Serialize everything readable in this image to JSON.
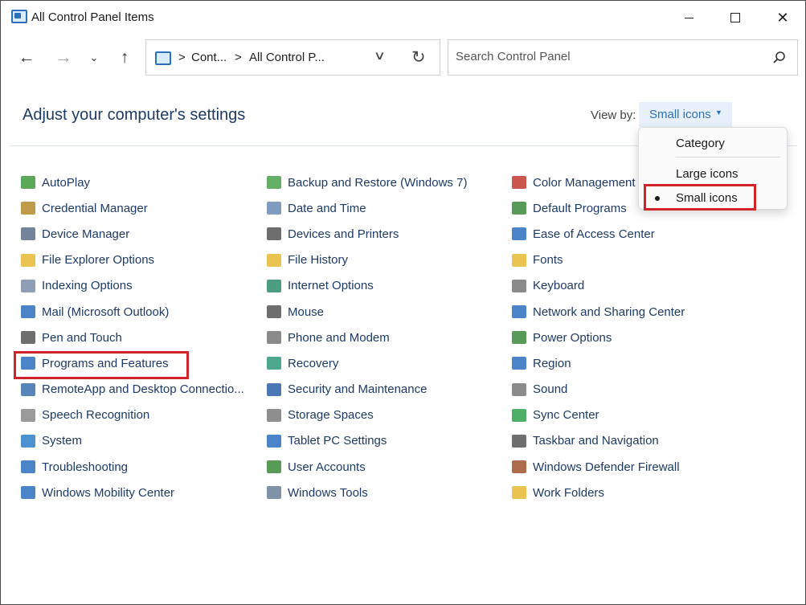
{
  "window": {
    "title": "All Control Panel Items",
    "close_glyph": "✕"
  },
  "nav": {
    "back_glyph": "←",
    "forward_glyph": "→",
    "recent_glyph": "⌄",
    "up_glyph": "↑"
  },
  "address": {
    "sep": ">",
    "segments": [
      "Cont...",
      "All Control P..."
    ],
    "dropdown_glyph": "∨",
    "refresh_glyph": "↻"
  },
  "search": {
    "placeholder": "Search Control Panel"
  },
  "header": {
    "title": "Adjust your computer's settings",
    "view_by_label": "View by:",
    "view_by_value": "Small icons",
    "view_by_caret": "▼"
  },
  "view_menu": {
    "items": [
      "Category",
      "Large icons",
      "Small icons"
    ],
    "selected": "Small icons"
  },
  "columns": [
    [
      {
        "label": "AutoPlay",
        "icon": "autoplay-icon",
        "color": "#3c9a3c"
      },
      {
        "label": "Credential Manager",
        "icon": "credential-manager-icon",
        "color": "#b58a2a"
      },
      {
        "label": "Device Manager",
        "icon": "device-manager-icon",
        "color": "#5a6f8a"
      },
      {
        "label": "File Explorer Options",
        "icon": "folder-options-icon",
        "color": "#e7b933"
      },
      {
        "label": "Indexing Options",
        "icon": "indexing-icon",
        "color": "#7a8ea8"
      },
      {
        "label": "Mail (Microsoft Outlook)",
        "icon": "mail-icon",
        "color": "#2d6fbf"
      },
      {
        "label": "Pen and Touch",
        "icon": "pen-icon",
        "color": "#555555"
      },
      {
        "label": "Programs and Features",
        "icon": "programs-icon",
        "color": "#2d6fbf"
      },
      {
        "label": "RemoteApp and Desktop Connectio...",
        "icon": "remoteapp-icon",
        "color": "#3b6fae"
      },
      {
        "label": "Speech Recognition",
        "icon": "microphone-icon",
        "color": "#8a8a8a"
      },
      {
        "label": "System",
        "icon": "system-icon",
        "color": "#2d7fc7"
      },
      {
        "label": "Troubleshooting",
        "icon": "troubleshooting-icon",
        "color": "#2d6fbf"
      },
      {
        "label": "Windows Mobility Center",
        "icon": "mobility-icon",
        "color": "#2d6fbf"
      }
    ],
    [
      {
        "label": "Backup and Restore (Windows 7)",
        "icon": "backup-icon",
        "color": "#4aa04a"
      },
      {
        "label": "Date and Time",
        "icon": "clock-icon",
        "color": "#6a8bb5"
      },
      {
        "label": "Devices and Printers",
        "icon": "printer-icon",
        "color": "#555555"
      },
      {
        "label": "File History",
        "icon": "file-history-icon",
        "color": "#e7b933"
      },
      {
        "label": "Internet Options",
        "icon": "globe-icon",
        "color": "#2e8c6a"
      },
      {
        "label": "Mouse",
        "icon": "mouse-icon",
        "color": "#555555"
      },
      {
        "label": "Phone and Modem",
        "icon": "phone-icon",
        "color": "#777777"
      },
      {
        "label": "Recovery",
        "icon": "recovery-icon",
        "color": "#2e9a7a"
      },
      {
        "label": "Security and Maintenance",
        "icon": "flag-icon",
        "color": "#2d5fa8"
      },
      {
        "label": "Storage Spaces",
        "icon": "storage-icon",
        "color": "#7a7a7a"
      },
      {
        "label": "Tablet PC Settings",
        "icon": "tablet-icon",
        "color": "#2d6fbf"
      },
      {
        "label": "User Accounts",
        "icon": "users-icon",
        "color": "#3a8a3a"
      },
      {
        "label": "Windows Tools",
        "icon": "tools-icon",
        "color": "#6a7f99"
      }
    ],
    [
      {
        "label": "Color Management",
        "icon": "color-management-icon",
        "color": "#c0392b"
      },
      {
        "label": "Default Programs",
        "icon": "default-programs-icon",
        "color": "#3a8a3a"
      },
      {
        "label": "Ease of Access Center",
        "icon": "ease-of-access-icon",
        "color": "#2d6fbf"
      },
      {
        "label": "Fonts",
        "icon": "fonts-icon",
        "color": "#e7b933"
      },
      {
        "label": "Keyboard",
        "icon": "keyboard-icon",
        "color": "#777777"
      },
      {
        "label": "Network and Sharing Center",
        "icon": "network-icon",
        "color": "#2d6fbf"
      },
      {
        "label": "Power Options",
        "icon": "power-icon",
        "color": "#3a8a3a"
      },
      {
        "label": "Region",
        "icon": "region-icon",
        "color": "#2d6fbf"
      },
      {
        "label": "Sound",
        "icon": "speaker-icon",
        "color": "#777777"
      },
      {
        "label": "Sync Center",
        "icon": "sync-icon",
        "color": "#2ea04a"
      },
      {
        "label": "Taskbar and Navigation",
        "icon": "taskbar-icon",
        "color": "#555555"
      },
      {
        "label": "Windows Defender Firewall",
        "icon": "firewall-icon",
        "color": "#a0522d"
      },
      {
        "label": "Work Folders",
        "icon": "work-folders-icon",
        "color": "#e7b933"
      }
    ]
  ],
  "colors": {
    "link": "#1e3a68",
    "accent": "#2d6fbf",
    "highlight": "#d2232a"
  }
}
